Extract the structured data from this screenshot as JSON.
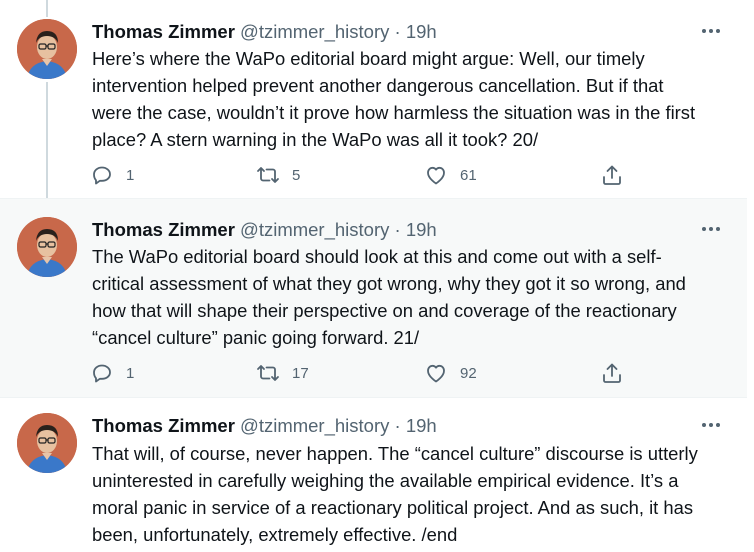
{
  "tweets": [
    {
      "author": "Thomas Zimmer",
      "handle": "@tzimmer_history",
      "separator": "·",
      "time": "19h",
      "lines": [
        "Here’s where the WaPo editorial board might argue: Well, our timely",
        "intervention helped prevent another dangerous cancellation. But if that",
        "were the case, wouldn’t it prove how harmless the situation was in the first",
        "place? A stern warning in the WaPo was all it took? 20/"
      ],
      "replies": "1",
      "retweets": "5",
      "likes": "61"
    },
    {
      "author": "Thomas Zimmer",
      "handle": "@tzimmer_history",
      "separator": "·",
      "time": "19h",
      "lines": [
        "The WaPo editorial board should look at this and come out with a self-",
        "critical assessment of what they got wrong, why they got it so wrong, and",
        "how that will shape their perspective on and coverage of the reactionary",
        "“cancel culture” panic going forward. 21/"
      ],
      "replies": "1",
      "retweets": "17",
      "likes": "92"
    },
    {
      "author": "Thomas Zimmer",
      "handle": "@tzimmer_history",
      "separator": "·",
      "time": "19h",
      "lines": [
        "That will, of course, never happen. The “cancel culture” discourse is utterly",
        "uninterested in carefully weighing the available empirical evidence. It’s a",
        "moral panic in service of a reactionary political project. And as such, it has",
        "been, unfortunately, extremely effective. /end"
      ]
    }
  ],
  "icons": {
    "more": "more-horizontal-icon",
    "reply": "reply-icon",
    "retweet": "retweet-icon",
    "like": "heart-icon",
    "share": "share-icon"
  },
  "colors": {
    "text": "#0f1419",
    "secondary": "#536471",
    "thread_line": "#cfd9de",
    "highlight_bg": "#f7f9f9",
    "avatar_bg": "#c8684a"
  }
}
